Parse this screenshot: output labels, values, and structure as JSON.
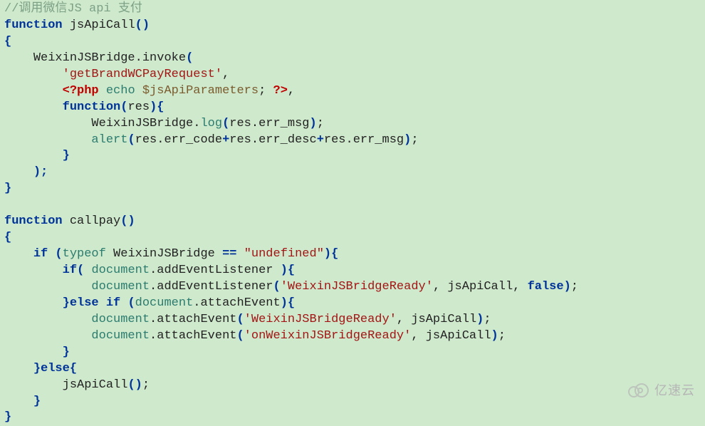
{
  "lines": {
    "l1_comment": "//调用微信JS api 支付",
    "l2_function": "function",
    "l2_name": " jsApiCall",
    "l2_parens": "()",
    "l3_br": "{",
    "l4_indent": "    ",
    "l4_ident": "WeixinJSBridge.invoke",
    "l4_paren": "(",
    "l5_indent": "        ",
    "l5_str": "'getBrandWCPayRequest'",
    "l5_comma": ",",
    "l6_indent": "        ",
    "l6_php_open": "<?php",
    "l6_echo": " echo ",
    "l6_var": "$jsApiParameters",
    "l6_semi": "; ",
    "l6_php_close": "?>",
    "l6_comma": ",",
    "l7_indent": "        ",
    "l7_function": "function",
    "l7_paren_o": "(",
    "l7_arg": "res",
    "l7_paren_c": ")",
    "l7_br": "{",
    "l8_indent": "            ",
    "l8_ident": "WeixinJSBridge.",
    "l8_log": "log",
    "l8_paren_o": "(",
    "l8_arg": "res.err_msg",
    "l8_paren_c": ")",
    "l8_semi": ";",
    "l9_indent": "            ",
    "l9_alert": "alert",
    "l9_paren_o": "(",
    "l9_a1": "res.err_code",
    "l9_plus1": "+",
    "l9_a2": "res.err_desc",
    "l9_plus2": "+",
    "l9_a3": "res.err_msg",
    "l9_paren_c": ")",
    "l9_semi": ";",
    "l10_indent": "        ",
    "l10_br": "}",
    "l11_indent": "    ",
    "l11_close": ");",
    "l12_br": "}",
    "l14_function": "function",
    "l14_name": " callpay",
    "l14_parens": "()",
    "l15_br": "{",
    "l16_indent": "    ",
    "l16_if": "if",
    "l16_sp": " ",
    "l16_po": "(",
    "l16_typeof": "typeof",
    "l16_sp2": " ",
    "l16_ident": "WeixinJSBridge ",
    "l16_eq": "==",
    "l16_sp3": " ",
    "l16_str": "\"undefined\"",
    "l16_pc": ")",
    "l16_br": "{",
    "l17_indent": "        ",
    "l17_if": "if",
    "l17_po": "(",
    "l17_sp": " ",
    "l17_doc": "document",
    "l17_rest": ".addEventListener ",
    "l17_pc": ")",
    "l17_br": "{",
    "l18_indent": "            ",
    "l18_doc": "document",
    "l18_rest": ".addEventListener",
    "l18_po": "(",
    "l18_str": "'WeixinJSBridgeReady'",
    "l18_comma1": ",",
    "l18_arg1": " jsApiCall",
    "l18_comma2": ",",
    "l18_sp": " ",
    "l18_false": "false",
    "l18_pc": ")",
    "l18_semi": ";",
    "l19_indent": "        ",
    "l19_br": "}",
    "l19_else": "else if ",
    "l19_po": "(",
    "l19_doc": "document",
    "l19_rest": ".attachEvent",
    "l19_pc": ")",
    "l19_br2": "{",
    "l20_indent": "            ",
    "l20_doc": "document",
    "l20_rest": ".attachEvent",
    "l20_po": "(",
    "l20_str": "'WeixinJSBridgeReady'",
    "l20_comma": ",",
    "l20_arg": " jsApiCall",
    "l20_pc": ")",
    "l20_semi": ";",
    "l21_indent": "            ",
    "l21_doc": "document",
    "l21_rest": ".attachEvent",
    "l21_po": "(",
    "l21_str": "'onWeixinJSBridgeReady'",
    "l21_comma": ",",
    "l21_arg": " jsApiCall",
    "l21_pc": ")",
    "l21_semi": ";",
    "l22_indent": "        ",
    "l22_br": "}",
    "l23_indent": "    ",
    "l23_br": "}",
    "l23_else": "else",
    "l23_br2": "{",
    "l24_indent": "        ",
    "l24_ident": "jsApiCall",
    "l24_parens": "()",
    "l24_semi": ";",
    "l25_indent": "    ",
    "l25_br": "}",
    "l26_br": "}"
  },
  "watermark_text": "亿速云"
}
